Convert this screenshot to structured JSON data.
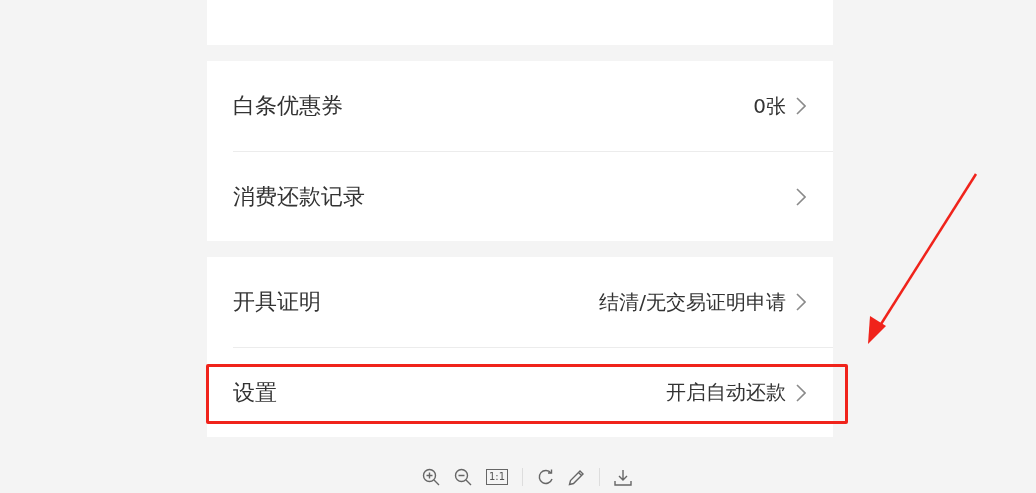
{
  "cards": [
    {
      "rows": [
        {
          "label": "白条优惠券",
          "value": "0张",
          "annotated": false
        },
        {
          "label": "消费还款记录",
          "value": "",
          "annotated": false
        }
      ]
    },
    {
      "rows": [
        {
          "label": "开具证明",
          "value": "结清/无交易证明申请",
          "annotated": false
        },
        {
          "label": "设置",
          "value": "开启自动还款",
          "annotated": true
        }
      ]
    }
  ],
  "viewer_toolbar": {
    "actual_size_label": "1:1"
  }
}
